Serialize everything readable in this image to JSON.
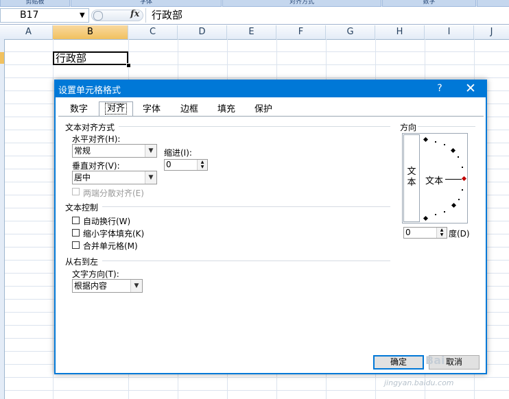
{
  "ribbon": {
    "groups": [
      "剪贴板",
      "字体",
      "对齐方式",
      "数字"
    ]
  },
  "formula_bar": {
    "name_box": "B17",
    "fx_label": "fx",
    "content": "行政部"
  },
  "grid": {
    "columns": [
      "A",
      "B",
      "C",
      "D",
      "E",
      "F",
      "G",
      "H",
      "I",
      "J"
    ],
    "selected_column": "B",
    "active_cell_value": "行政部"
  },
  "dialog": {
    "title": "设置单元格格式",
    "help": "?",
    "close": "✕",
    "tabs": [
      "数字",
      "对齐",
      "字体",
      "边框",
      "填充",
      "保护"
    ],
    "active_tab": "对齐",
    "text_alignment": {
      "group_title": "文本对齐方式",
      "horizontal_label": "水平对齐(H):",
      "horizontal_value": "常规",
      "indent_label": "缩进(I):",
      "indent_value": "0",
      "vertical_label": "垂直对齐(V):",
      "vertical_value": "居中",
      "distributed_label": "两端分散对齐(E)"
    },
    "text_control": {
      "group_title": "文本控制",
      "wrap_text": "自动换行(W)",
      "shrink_to_fit": "缩小字体填充(K)",
      "merge_cells": "合并单元格(M)"
    },
    "rtl": {
      "group_title": "从右到左",
      "direction_label": "文字方向(T):",
      "direction_value": "根据内容"
    },
    "orientation": {
      "group_title": "方向",
      "vertical_text": "文本",
      "horizontal_text": "文本",
      "degrees_value": "0",
      "degrees_label": "度(D)"
    },
    "ok_label": "确定",
    "cancel_label": "取消"
  },
  "watermark": {
    "logo": "Bai",
    "url": "jingyan.baidu.com"
  }
}
